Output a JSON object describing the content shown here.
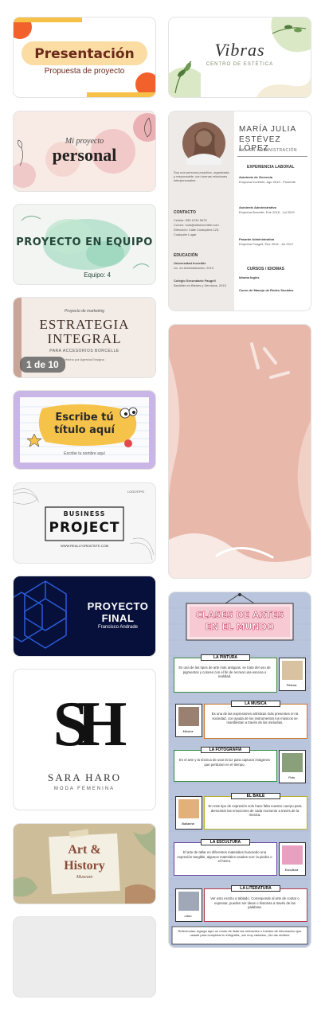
{
  "templates": {
    "presentacion": {
      "title": "Presentación",
      "subtitle": "Propuesta de proyecto"
    },
    "vibras": {
      "title": "Vibras",
      "subtitle": "CENTRO DE ESTÉTICA"
    },
    "personal": {
      "script": "Mi proyecto",
      "title": "personal"
    },
    "resume": {
      "name_line1": "MARÍA JULIA",
      "name_line2": "ESTÉVEZ LÓPEZ",
      "role": "LIC. EN ADMINISTRACIÓN",
      "intro": "Soy una persona proactiva, organizada y responsable, con buenas relaciones interpersonales.",
      "contact_heading": "CONTACTO",
      "contact_lines": [
        "Celular: 555 1234 5678",
        "Correo: hola@sitioincreible.com",
        "Dirección: Calle Cualquiera 123, Cualquier Lugar"
      ],
      "education_heading": "EDUCACIÓN",
      "education_lines": [
        "Universidad Increíble",
        "Lic. en Administración, 2019",
        "Colegio Secundario Faugell",
        "Bachiller en Bienes y Servicios, 2015"
      ],
      "experience_heading": "EXPERIENCIA LABORAL",
      "experience_lines": [
        "Asistente de Gerencia",
        "Empresa Increíble, Ago 2019 - Presente",
        "Asistente Administrativa",
        "Empresa Borcelle, Ene 2018 - Jul 2019",
        "Pasante Administrativa",
        "Empresa Faugell, Ene 2016 - Jul 2017"
      ],
      "courses_heading": "CURSOS / IDIOMAS",
      "courses_lines": [
        "Idioma Inglés",
        "Curso de Manejo de Redes Sociales"
      ]
    },
    "proyecto_equipo": {
      "title": "PROYECTO EN EQUIPO",
      "subtitle": "Equipo: 4"
    },
    "estrategia": {
      "kicker": "Proyecto de marketing",
      "title_line1": "ESTRATEGIA",
      "title_line2": "INTEGRAL",
      "subtitle": "PARA ACCESORIOS BORCELLE",
      "author": "Hecho por Agencia Ensigna",
      "badge": "1 de 10"
    },
    "escribe": {
      "title_line1": "Escribe tú",
      "title_line2": "título aquí",
      "subtitle": "Escribe tu nombre aquí"
    },
    "business": {
      "title_line1": "BUSINESS",
      "title_line2": "PROJECT",
      "url": "WWW.REALLYGREATSITE.COM",
      "logo": "LOGOTIPO"
    },
    "proyecto_final": {
      "title_line1": "PROYECTO",
      "title_line2": "FINAL",
      "author": "Francisco Andrade"
    },
    "sara_haro": {
      "monogram": "SH",
      "name": "SARA HARO",
      "tagline": "MODA FEMENINA"
    },
    "art_history": {
      "line1": "Art",
      "amp": "&",
      "line2": "History",
      "line3": "Museum"
    },
    "clases": {
      "title_line1": "CLASES DE ARTES",
      "title_line2": "EN EL MUNDO",
      "sections": [
        {
          "label": "LA PINTURA",
          "text": "Es una de las tipos de arte más antiguas, se trata del uso de pigmentos y colores con el fin de recrear una escena o realidad.",
          "caption": "Pintura",
          "color": "#3f8a3f"
        },
        {
          "label": "LA MÚSICA",
          "text": "Es una de las expresiones artísticas más presentes en la sociedad, con ayuda de los instrumentos los músicos se manifiestan a través de las melodías.",
          "caption": "Música",
          "color": "#c97a25"
        },
        {
          "label": "LA FOTOGRAFÍA",
          "text": "Es el arte y la técnica de usar la luz para capturar imágenes que perduran en el tiempo.",
          "caption": "Foto",
          "color": "#2f8a3f"
        },
        {
          "label": "EL BAILE",
          "text": "En este tipo de expresión solo hace falta nuestro cuerpo para demostrar las emociones de cada momento a través de la música.",
          "caption": "Bailarina",
          "color": "#b8b02a"
        },
        {
          "label": "LA ESCULTURA",
          "text": "El arte de tallar en diferentes materiales buscando una expresión tangible, algunos materiales usados son: la piedra o el hierro.",
          "caption": "Escultura",
          "color": "#6a3fa0"
        },
        {
          "label": "LA LITERATURA",
          "text": "Ver esto escrito a tablado. Corresponde al arte de contar o expresar, pueden ser ideas o historias a través de las palabras.",
          "caption": "Libro",
          "color": "#b33a4a"
        }
      ],
      "footer": "Referencias: Agrega aquí un modo de listar las referentes o fuentes de información que usaste para completar tu infografía, ¡sin muy variados, ¡No las olvides!"
    }
  }
}
